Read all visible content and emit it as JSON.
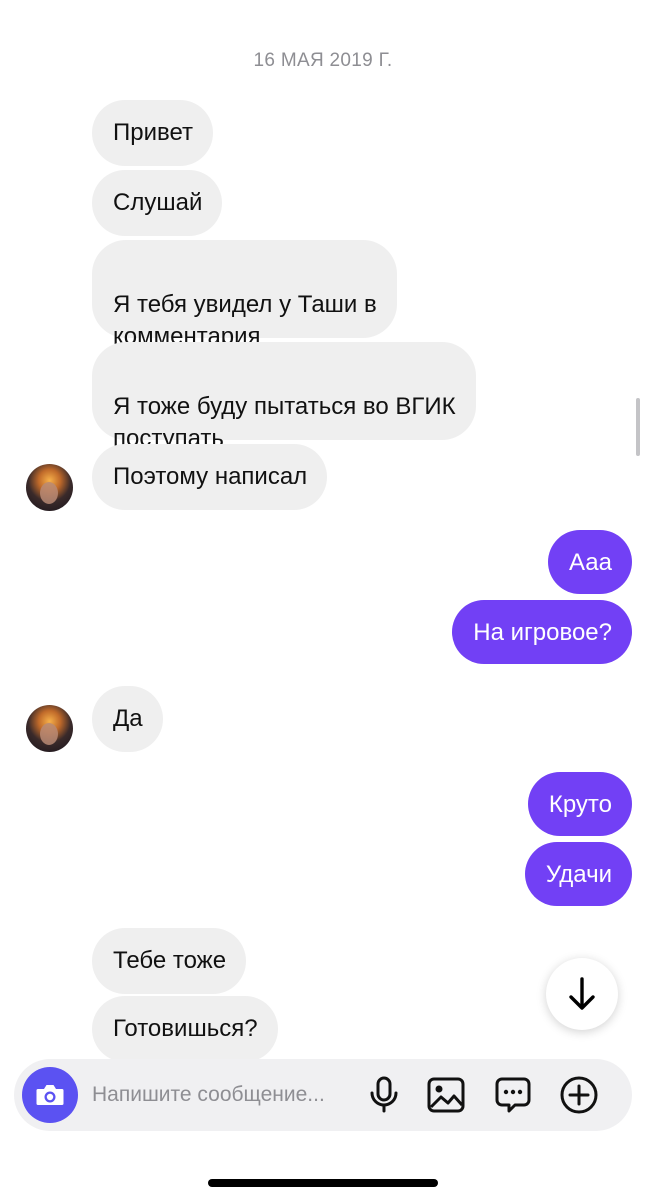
{
  "chat": {
    "date": "16 МАЯ 2019 Г.",
    "messages": [
      {
        "dir": "in",
        "text": "Привет"
      },
      {
        "dir": "in",
        "text": "Слушай"
      },
      {
        "dir": "in",
        "text": "Я тебя увидел у Таши в\nкомментария"
      },
      {
        "dir": "in",
        "text": "Я тоже буду пытаться во ВГИК\nпоступать"
      },
      {
        "dir": "in",
        "text": "Поэтому написал"
      },
      {
        "dir": "out",
        "text": "Ааа"
      },
      {
        "dir": "out",
        "text": "На игровое?"
      },
      {
        "dir": "in",
        "text": "Да"
      },
      {
        "dir": "out",
        "text": "Круто"
      },
      {
        "dir": "out",
        "text": "Удачи"
      },
      {
        "dir": "in",
        "text": "Тебе тоже"
      },
      {
        "dir": "in",
        "text": "Готовишься?"
      }
    ]
  },
  "composer": {
    "placeholder": "Напишите сообщение...",
    "icons": [
      "camera-icon",
      "microphone-icon",
      "image-icon",
      "sticker-chat-icon",
      "add-icon"
    ]
  },
  "colors": {
    "outgoing_bubble": "#7240f5",
    "incoming_bubble": "#efefef",
    "camera_button": "#5b52f2"
  }
}
